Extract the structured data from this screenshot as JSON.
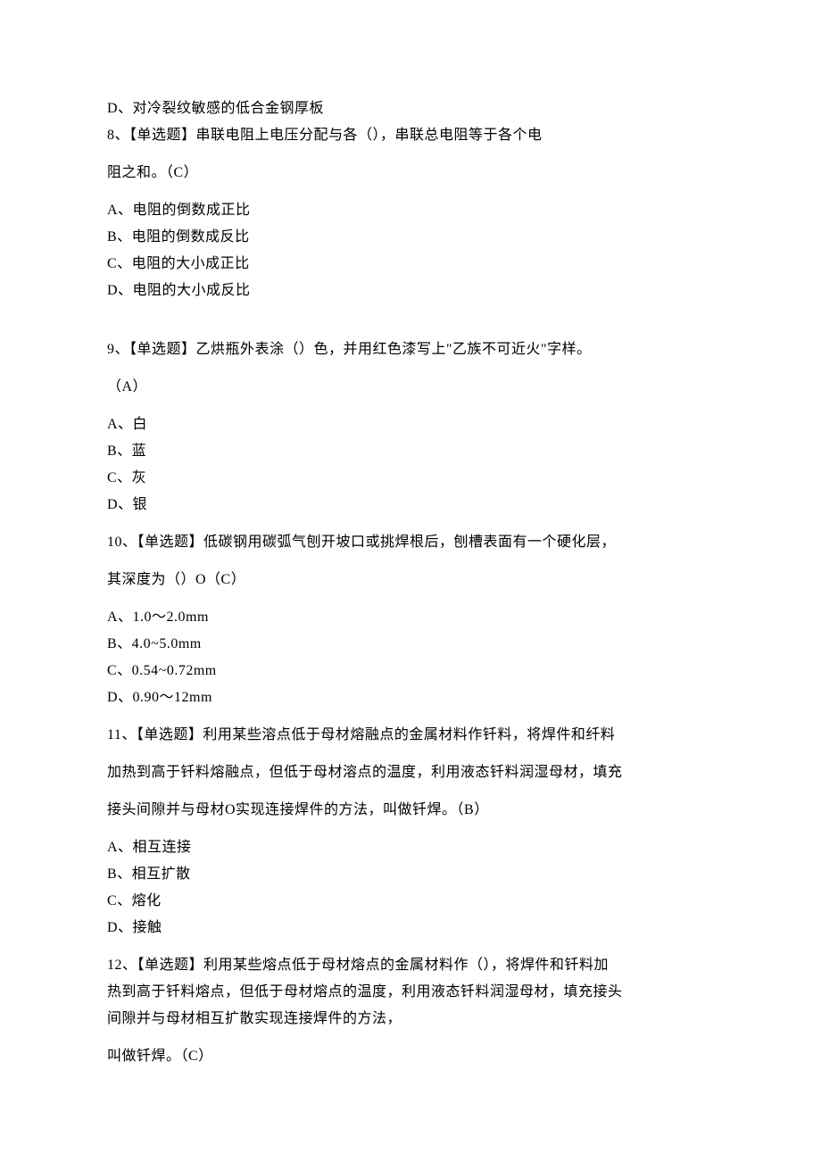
{
  "q7_d": "D、对冷裂纹敏感的低合金钢厚板",
  "q8_stem_line1": "8、【单选题】串联电阻上电压分配与各（），串联总电阻等于各个电",
  "q8_stem_line2": "阻之和。（C）",
  "q8_a": "A、电阻的倒数成正比",
  "q8_b": "B、电阻的倒数成反比",
  "q8_c": "C、电阻的大小成正比",
  "q8_d": "D、电阻的大小成反比",
  "q9_stem_line1": "9、【单选题】乙烘瓶外表涂（）色，并用红色漆写上\"乙族不可近火\"字样。",
  "q9_stem_line2": "（A）",
  "q9_a": "A、白",
  "q9_b": "B、蓝",
  "q9_c": "C、灰",
  "q9_d": "D、银",
  "q10_stem_line1": "10、【单选题】低碳钢用碳弧气刨开坡口或挑焊根后，刨槽表面有一个硬化层，",
  "q10_stem_line2": "其深度为（）O（C）",
  "q10_a": "A、1.0～2.0mm",
  "q10_b": "B、4.0~5.0mm",
  "q10_c": "C、0.54~0.72mm",
  "q10_d": "D、0.90～12mm",
  "q11_stem_line1": "11、【单选题】利用某些溶点低于母材熔融点的金属材料作钎料，将焊件和纤料",
  "q11_stem_line2": "加热到高于钎料熔融点，但低于母材溶点的温度，利用液态钎料润湿母材，填充",
  "q11_stem_line3": "接头间隙并与母材O实现连接焊件的方法，叫做钎焊。（B）",
  "q11_a": "A、相互连接",
  "q11_b": "B、相互扩散",
  "q11_c": "C、熔化",
  "q11_d": "D、接触",
  "q12_stem_line1": "12、【单选题】利用某些熔点低于母材熔点的金属材料作（），将焊件和钎料加",
  "q12_stem_line2": "热到高于钎料熔点，但低于母材熔点的温度，利用液态钎料润湿母材，填充接头",
  "q12_stem_line3": "间隙并与母材相互扩散实现连接焊件的方法，",
  "q12_stem_line4": "叫做钎焊。（C）"
}
